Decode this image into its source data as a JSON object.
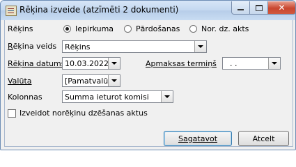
{
  "window": {
    "title": "Rēķina izveide (atzīmēti 2 dokumenti)",
    "close_glyph": "✕"
  },
  "form": {
    "type_label": "Rēķins",
    "type_options": [
      {
        "label": "Iepirkuma",
        "selected": true
      },
      {
        "label": "Pārdošanas",
        "selected": false
      },
      {
        "label": "Nor. dz. akts",
        "selected": false
      }
    ],
    "invoice_kind_label_u": "R",
    "invoice_kind_label_rest": "ēķina veids",
    "invoice_kind_value": "Rēķins",
    "date_label_u": "Rēķina datums",
    "date_value": "10.03.2022",
    "due_label_u": "Apmaksas termiņš",
    "due_value": " .  .  ",
    "currency_label_u": "Valūta",
    "currency_value": "[Pamatvalūta]",
    "columns_label": "Kolonnas",
    "columns_value": "Summa ieturot komisi",
    "checkbox_label": "Izveidot norēķinu dzēšanas aktus",
    "checkbox_checked": false
  },
  "buttons": {
    "create": "Sagatavot",
    "cancel": "Atcelt"
  }
}
